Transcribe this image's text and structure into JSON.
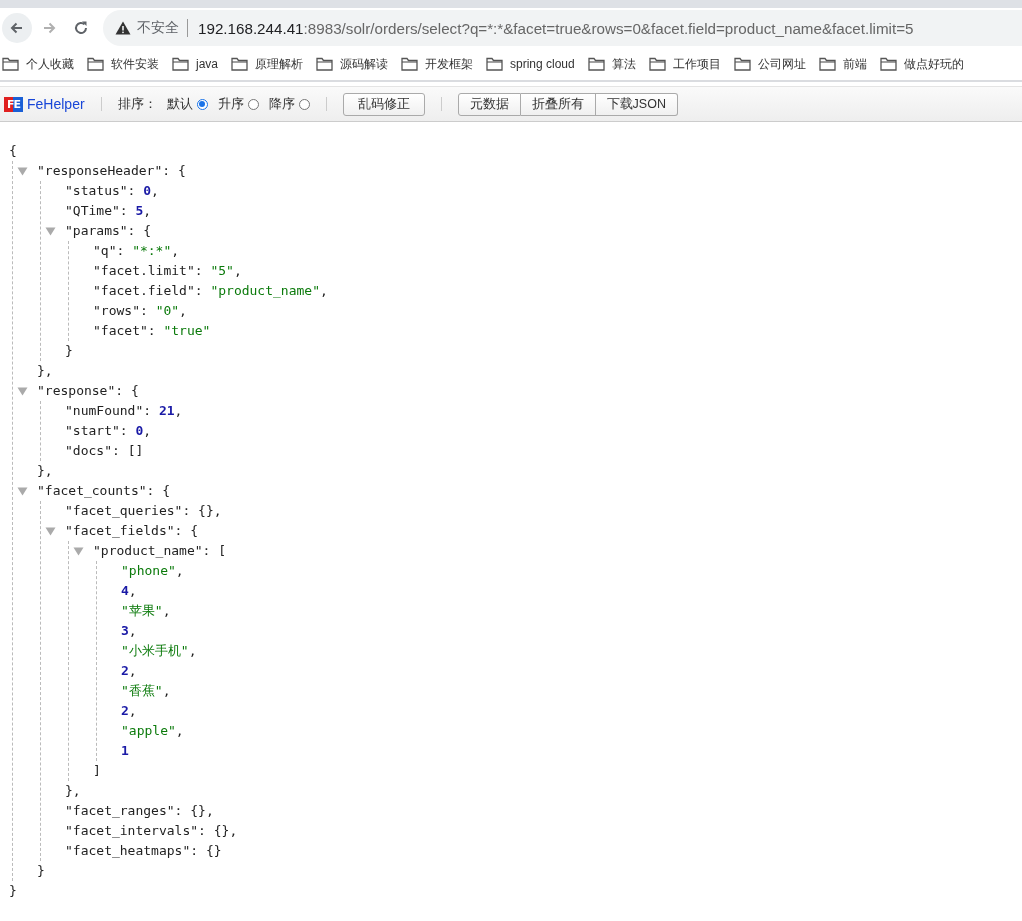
{
  "browser": {
    "nav": [
      {
        "kind": "back",
        "disabled": false
      },
      {
        "kind": "forward",
        "disabled": true
      },
      {
        "kind": "reload",
        "disabled": false
      }
    ],
    "security_label": "不安全",
    "url": {
      "host": "192.168.244.41",
      "path": ":8983/solr/orders/select?q=*:*&facet=true&rows=0&facet.field=product_name&facet.limit=5"
    },
    "bookmarks": [
      "个人收藏",
      "软件安装",
      "java",
      "原理解析",
      "源码解读",
      "开发框架",
      "spring cloud",
      "算法",
      "工作项目",
      "公司网址",
      "前端",
      "做点好玩的"
    ]
  },
  "toolbar": {
    "logo_mark": "FE",
    "brand": "FeHelper",
    "sort_label": "排序：",
    "sort_options": [
      {
        "label": "默认",
        "selected": true
      },
      {
        "label": "升序",
        "selected": false
      },
      {
        "label": "降序",
        "selected": false
      }
    ],
    "fix_button": "乱码修正",
    "buttons": [
      "元数据",
      "折叠所有",
      "下载JSON"
    ]
  },
  "json": {
    "open": "{",
    "close": "}",
    "children": [
      {
        "kind": "object",
        "key": "\"responseHeader\":",
        "open": "{",
        "expanded": true,
        "close": "}",
        "end": ",",
        "children": [
          {
            "kind": "number",
            "key": "\"status\":",
            "value": "0",
            "end": ","
          },
          {
            "kind": "number",
            "key": "\"QTime\":",
            "value": "5",
            "end": ","
          },
          {
            "kind": "object",
            "key": "\"params\":",
            "open": "{",
            "expanded": true,
            "close": "}",
            "children": [
              {
                "kind": "string",
                "key": "\"q\":",
                "value": "\"*:*\"",
                "end": ","
              },
              {
                "kind": "string",
                "key": "\"facet.limit\":",
                "value": "\"5\"",
                "end": ","
              },
              {
                "kind": "string",
                "key": "\"facet.field\":",
                "value": "\"product_name\"",
                "end": ","
              },
              {
                "kind": "string",
                "key": "\"rows\":",
                "value": "\"0\"",
                "end": ","
              },
              {
                "kind": "string",
                "key": "\"facet\":",
                "value": "\"true\""
              }
            ]
          }
        ]
      },
      {
        "kind": "object",
        "key": "\"response\":",
        "open": "{",
        "expanded": true,
        "close": "}",
        "end": ",",
        "children": [
          {
            "kind": "number",
            "key": "\"numFound\":",
            "value": "21",
            "end": ","
          },
          {
            "kind": "number",
            "key": "\"start\":",
            "value": "0",
            "end": ","
          },
          {
            "kind": "empty",
            "key": "\"docs\":",
            "value": "[]"
          }
        ]
      },
      {
        "kind": "object",
        "key": "\"facet_counts\":",
        "open": "{",
        "expanded": true,
        "close": "}",
        "children": [
          {
            "kind": "empty",
            "key": "\"facet_queries\":",
            "value": "{}",
            "end": ","
          },
          {
            "kind": "object",
            "key": "\"facet_fields\":",
            "open": "{",
            "expanded": true,
            "close": "}",
            "end": ",",
            "children": [
              {
                "kind": "object",
                "key": "\"product_name\":",
                "open": "[",
                "expanded": true,
                "close": "]",
                "children": [
                  {
                    "kind": "string",
                    "value": "\"phone\"",
                    "end": ","
                  },
                  {
                    "kind": "number",
                    "value": "4",
                    "end": ","
                  },
                  {
                    "kind": "string",
                    "value": "\"苹果\"",
                    "end": ","
                  },
                  {
                    "kind": "number",
                    "value": "3",
                    "end": ","
                  },
                  {
                    "kind": "string",
                    "value": "\"小米手机\"",
                    "end": ","
                  },
                  {
                    "kind": "number",
                    "value": "2",
                    "end": ","
                  },
                  {
                    "kind": "string",
                    "value": "\"香蕉\"",
                    "end": ","
                  },
                  {
                    "kind": "number",
                    "value": "2",
                    "end": ","
                  },
                  {
                    "kind": "string",
                    "value": "\"apple\"",
                    "end": ","
                  },
                  {
                    "kind": "number",
                    "value": "1"
                  }
                ]
              }
            ]
          },
          {
            "kind": "empty",
            "key": "\"facet_ranges\":",
            "value": "{}",
            "end": ","
          },
          {
            "kind": "empty",
            "key": "\"facet_intervals\":",
            "value": "{}",
            "end": ","
          },
          {
            "kind": "empty",
            "key": "\"facet_heatmaps\":",
            "value": "{}"
          }
        ]
      }
    ]
  }
}
